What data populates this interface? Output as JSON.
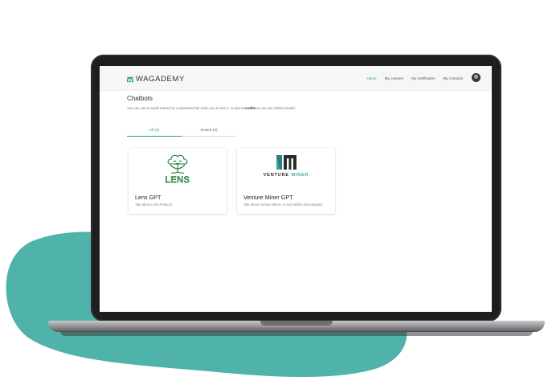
{
  "colors": {
    "accent": "#2e9a8c",
    "blob": "#4fb3a9",
    "lens_green": "#1e7a2e",
    "vm_teal": "#3da8a0"
  },
  "nav": {
    "logo_text": "WAGADEMY",
    "links": [
      "Home",
      "My courses",
      "My certificates",
      "My contacts"
    ]
  },
  "page": {
    "title": "Chatbots",
    "subtitle_pre": "You can use a model trained by companies that invite you to test it, or spend ",
    "subtitle_bold": "credits",
    "subtitle_post": " to use any trained model."
  },
  "tabs": [
    {
      "label": "All (2)"
    },
    {
      "label": "Invited (0)"
    }
  ],
  "cards": [
    {
      "title": "Lens GPT",
      "description": "Talk about Lens Protocol.",
      "logo_text": "LENS",
      "icon": "lens-tree-icon"
    },
    {
      "title": "Venture Miner GPT",
      "description": "Talk about Venture Miner, AI and WEB3 technologies.",
      "logo_word1": "VENTURE",
      "logo_word2": "MINER",
      "icon": "venture-miner-logo-icon"
    }
  ]
}
